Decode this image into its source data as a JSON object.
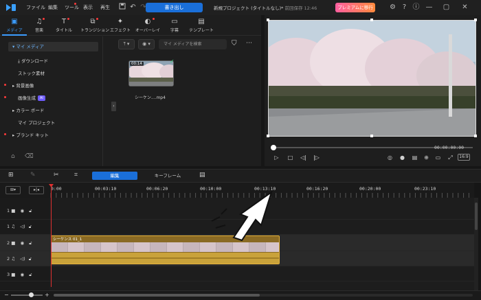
{
  "menu": {
    "items": [
      {
        "label": "ファイル"
      },
      {
        "label": "編集"
      },
      {
        "label": "ツール"
      },
      {
        "label": "表示"
      },
      {
        "label": "再生"
      }
    ],
    "export_label": "書き出し",
    "project_title": "新規プロジェクト (タイトルなし)*",
    "save_status": "前回保存 12:46",
    "premium_label": "プレミアムに移行"
  },
  "media_tabs": [
    {
      "label": "メディア",
      "icon": "media-icon"
    },
    {
      "label": "音楽",
      "icon": "music-icon"
    },
    {
      "label": "タイトル",
      "icon": "title-icon"
    },
    {
      "label": "トランジション",
      "icon": "transition-icon"
    },
    {
      "label": "エフェクト",
      "icon": "effect-icon"
    },
    {
      "label": "オーバーレイ",
      "icon": "overlay-icon"
    },
    {
      "label": "字幕",
      "icon": "subtitle-icon"
    },
    {
      "label": "テンプレート",
      "icon": "template-icon"
    }
  ],
  "sidebar": {
    "items": [
      {
        "label": "マイ メディア",
        "selected": true
      },
      {
        "label": "ダウンロード"
      },
      {
        "label": "ストック素材"
      },
      {
        "label": "背景画像"
      },
      {
        "label": "画像生成",
        "badge": "AI"
      },
      {
        "label": "カラー ボード"
      },
      {
        "label": "マイ プロジェクト"
      },
      {
        "label": "ブランド キット"
      }
    ]
  },
  "media": {
    "search_placeholder": "マイ メディアを検索",
    "thumb": {
      "duration": "00:14",
      "name": "シーケン....mp4"
    }
  },
  "preview": {
    "time": "00:00:00:00",
    "aspect": "16:9"
  },
  "timeline": {
    "tabs": [
      {
        "label": "編集"
      },
      {
        "label": "キーフレーム"
      }
    ],
    "ruler": [
      "0:00",
      "00:03:10",
      "00:06:20",
      "00:10:00",
      "00:13:10",
      "00:16:20",
      "00:20:00",
      "00:23:10"
    ],
    "tracks": [
      {
        "num": "1",
        "type": "video"
      },
      {
        "num": "1",
        "type": "audio"
      },
      {
        "num": "2",
        "type": "video"
      },
      {
        "num": "2",
        "type": "audio"
      },
      {
        "num": "3",
        "type": "video"
      }
    ],
    "clip_label": "シーケンス 01_1"
  },
  "colors": {
    "accent": "#1a6fd9",
    "clip": "#e6b23a",
    "playhead": "#e03030"
  }
}
